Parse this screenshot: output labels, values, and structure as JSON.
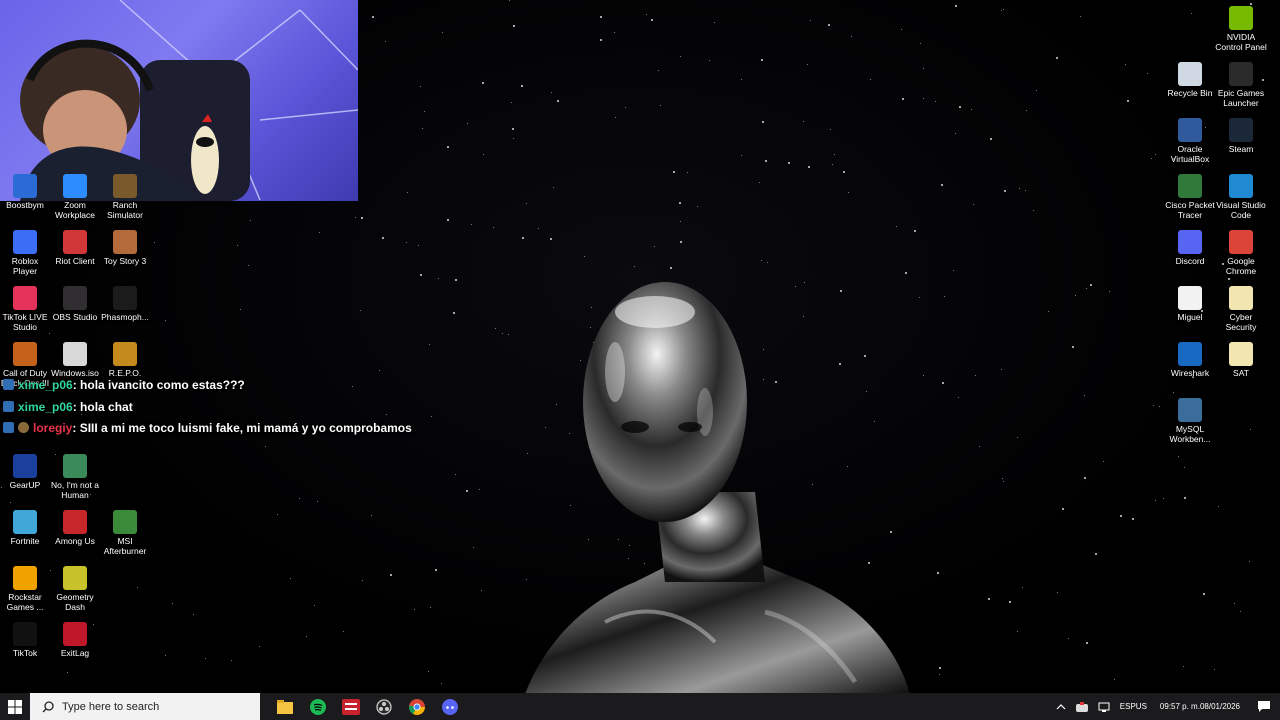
{
  "chat": [
    {
      "user": "xime_p06",
      "user_color": "#30d5a0",
      "message": ": hola ivancito como estas???",
      "badge": "mod"
    },
    {
      "user": "xime_p06",
      "user_color": "#30d5a0",
      "message": ": hola chat",
      "badge": "mod"
    },
    {
      "user": "loregiy",
      "user_color": "#e8334a",
      "message": ": SIII a mi me toco luismi fake, mi mamá y yo comprobamos",
      "badge": "avatar"
    }
  ],
  "left_icons": [
    {
      "label": "Boostbym",
      "icon": "app-icon",
      "color": "#2a6bd6"
    },
    {
      "label": "Zoom Workplace",
      "icon": "zoom-icon",
      "color": "#2d8cff"
    },
    {
      "label": "Ranch Simulator",
      "icon": "game-icon",
      "color": "#7a5a2a"
    },
    {
      "label": "Roblox Player",
      "icon": "roblox-icon",
      "color": "#3b6ef5"
    },
    {
      "label": "Riot Client",
      "icon": "riot-icon",
      "color": "#d13639"
    },
    {
      "label": "Toy Story 3",
      "icon": "game-icon",
      "color": "#b46a3a"
    },
    {
      "label": "TikTok LIVE Studio",
      "icon": "tiktok-live-icon",
      "color": "#e5325a"
    },
    {
      "label": "OBS Studio",
      "icon": "obs-icon",
      "color": "#302e31"
    },
    {
      "label": "Phasmoph...",
      "icon": "phasmophobia-icon",
      "color": "#1b1b1b"
    },
    {
      "label": "Call of Duty Black Ops III",
      "icon": "cod-icon",
      "color": "#c4621b"
    },
    {
      "label": "Windows.iso",
      "icon": "disc-icon",
      "color": "#d8d8d8"
    },
    {
      "label": "R.E.P.O.",
      "icon": "repo-icon",
      "color": "#c48a1b"
    },
    {
      "label": "GearUP",
      "icon": "gearup-icon",
      "color": "#1a3f9c"
    },
    {
      "label": "No, I'm not a Human",
      "icon": "game-icon",
      "color": "#3a8a5a"
    },
    {
      "label": "Fortnite",
      "icon": "fortnite-icon",
      "color": "#3fa8d9"
    },
    {
      "label": "Among Us",
      "icon": "among-us-icon",
      "color": "#c5272a"
    },
    {
      "label": "MSI Afterburner",
      "icon": "msi-icon",
      "color": "#3a8a3a"
    },
    {
      "label": "Rockstar Games ...",
      "icon": "rockstar-icon",
      "color": "#f0a300"
    },
    {
      "label": "Geometry Dash",
      "icon": "geometry-dash-icon",
      "color": "#c7c12a"
    },
    {
      "label": "TikTok",
      "icon": "tiktok-icon",
      "color": "#111111"
    },
    {
      "label": "ExitLag",
      "icon": "exitlag-icon",
      "color": "#c0182b"
    }
  ],
  "right_icons": [
    {
      "label": "NVIDIA Control Panel",
      "icon": "nvidia-icon",
      "color": "#76b900"
    },
    {
      "label": "Recycle Bin",
      "icon": "recycle-bin-icon",
      "color": "#cfd8e3"
    },
    {
      "label": "Epic Games Launcher",
      "icon": "epic-icon",
      "color": "#2a2a2a"
    },
    {
      "label": "Oracle VirtualBox",
      "icon": "virtualbox-icon",
      "color": "#2f5a9c"
    },
    {
      "label": "Steam",
      "icon": "steam-icon",
      "color": "#1b2838"
    },
    {
      "label": "Cisco Packet Tracer",
      "icon": "packet-tracer-icon",
      "color": "#2f7a3a"
    },
    {
      "label": "Visual Studio Code",
      "icon": "vscode-icon",
      "color": "#1f8ad2"
    },
    {
      "label": "Discord",
      "icon": "discord-icon",
      "color": "#5865f2"
    },
    {
      "label": "Google Chrome",
      "icon": "chrome-icon",
      "color": "#db4437"
    },
    {
      "label": "Miguel",
      "icon": "pdf-icon",
      "color": "#f2f2f2"
    },
    {
      "label": "Cyber Security",
      "icon": "document-icon",
      "color": "#f2e6b0"
    },
    {
      "label": "Wireshark",
      "icon": "wireshark-icon",
      "color": "#1769c2"
    },
    {
      "label": "SAT",
      "icon": "document-icon",
      "color": "#f2e6b0"
    },
    {
      "label": "MySQL Workben...",
      "icon": "mysql-icon",
      "color": "#3a6d9c"
    }
  ],
  "taskbar": {
    "search_placeholder": "Type here to search",
    "apps": [
      "file-explorer-icon",
      "spotify-icon",
      "twitter-app-icon",
      "obs-icon",
      "chrome-icon",
      "discord-icon"
    ],
    "lang_top": "ESP",
    "lang_bottom": "US",
    "time": "09:57 p. m.",
    "date": "08/01/2026"
  }
}
